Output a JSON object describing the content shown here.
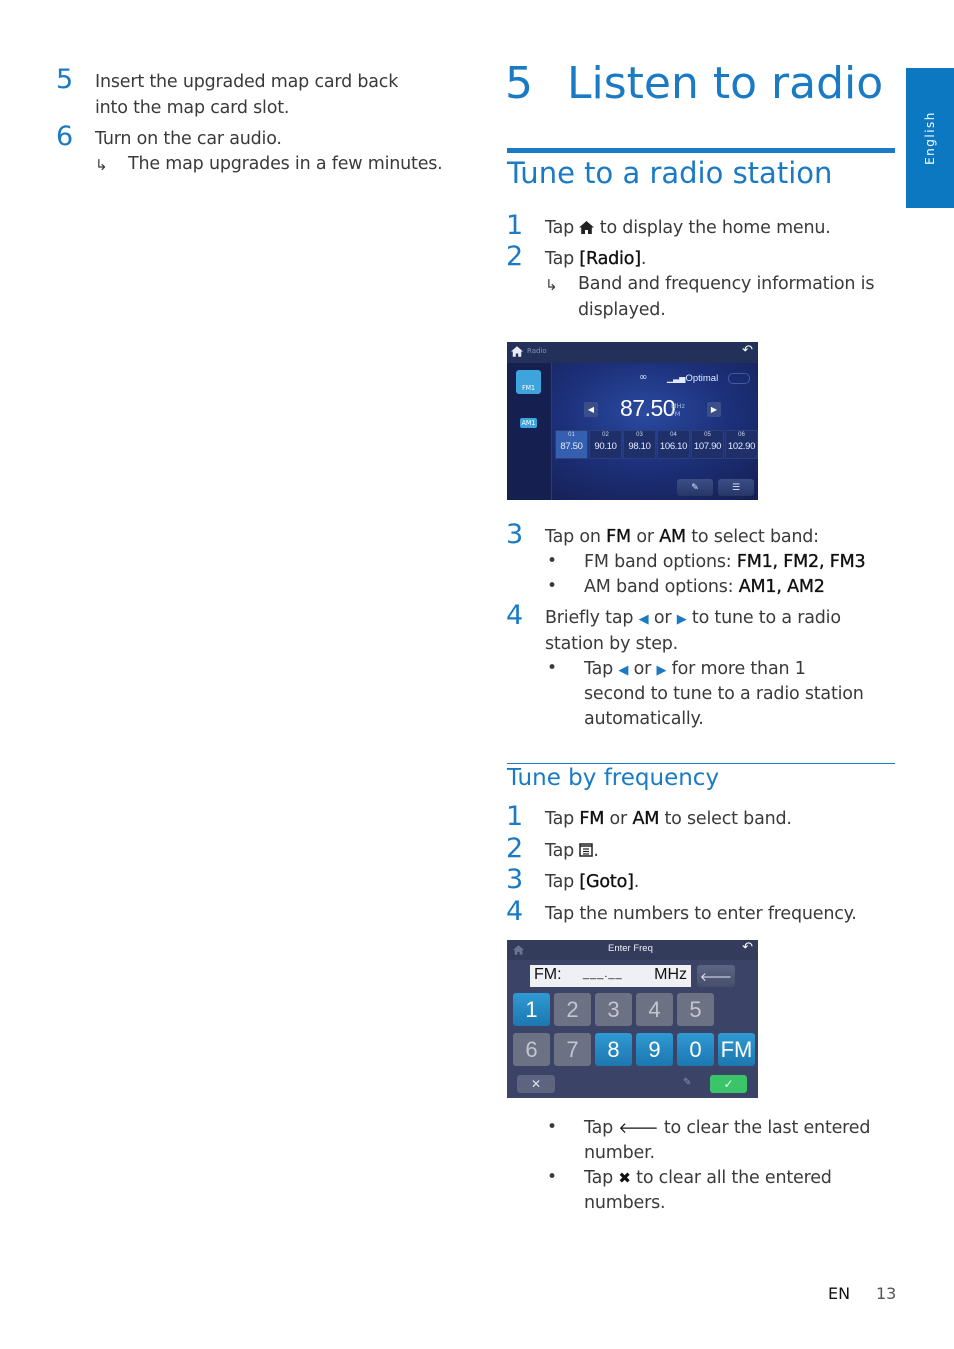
{
  "left_column": {
    "steps": [
      {
        "num": "5",
        "text": "Insert the upgraded map card back into the map card slot."
      },
      {
        "num": "6",
        "text": "Turn on the car audio.",
        "result": "The map upgrades in a few minutes."
      }
    ]
  },
  "chapter": {
    "number": "5",
    "title": "Listen to radio"
  },
  "section1": {
    "title": "Tune to a radio station",
    "step1": {
      "num": "1",
      "pre": "Tap",
      "icon": "home-icon",
      "post": "to display the home menu."
    },
    "step2": {
      "num": "2",
      "pre": "Tap",
      "key": "[Radio]",
      "post": ".",
      "result_line1": "Band and frequency information is",
      "result_line2": "displayed."
    },
    "step3": {
      "num": "3",
      "pre": "Tap on",
      "k1": "FM",
      "mid": "or",
      "k2": "AM",
      "post": "to select band:",
      "bullet1_pre": "FM band options:",
      "bullet1_key": "FM1, FM2, FM3",
      "bullet2_pre": "AM band options:",
      "bullet2_key": "AM1, AM2"
    },
    "step4": {
      "num": "4",
      "line1_pre": "Briefly tap",
      "or": "or",
      "line1_post": "to tune to a radio",
      "line2": "station by step.",
      "bullet_pre": "Tap",
      "bullet_or": "or",
      "bullet_post": "for more than 1",
      "bullet_line2": "second to tune to a radio station",
      "bullet_line3": "automatically."
    }
  },
  "radio_screen": {
    "top_label": "Radio",
    "bands": [
      "FM1",
      "AM1"
    ],
    "sound_mode": "Optimal",
    "frequency": "87.50",
    "unit": "MHz",
    "band": "FM",
    "presets": [
      {
        "num": "01",
        "freq": "87.50",
        "selected": true
      },
      {
        "num": "02",
        "freq": "90.10"
      },
      {
        "num": "03",
        "freq": "98.10"
      },
      {
        "num": "04",
        "freq": "106.10"
      },
      {
        "num": "05",
        "freq": "107.90"
      },
      {
        "num": "06",
        "freq": "102.90"
      }
    ]
  },
  "section2": {
    "title": "Tune by frequency",
    "steps": [
      {
        "num": "1",
        "pre": "Tap",
        "k1": "FM",
        "mid": "or",
        "k2": "AM",
        "post": "to select band."
      },
      {
        "num": "2",
        "pre": "Tap",
        "icon": "menu-list-icon",
        "post": "."
      },
      {
        "num": "3",
        "pre": "Tap",
        "key": "[Goto]",
        "post": "."
      },
      {
        "num": "4",
        "text": "Tap the numbers to enter frequency."
      }
    ],
    "bullets": [
      {
        "pre": "Tap",
        "icon": "backspace-arrow-icon",
        "post": "to clear the last entered",
        "line2": "number."
      },
      {
        "pre": "Tap",
        "icon": "x-icon",
        "post": "to clear all the entered",
        "line2": "numbers."
      }
    ]
  },
  "freq_screen": {
    "title": "Enter Freq",
    "display_band": "FM:",
    "display_value": "___.__",
    "display_unit": "MHz",
    "keys_row1": [
      {
        "label": "1",
        "on": true
      },
      {
        "label": "2",
        "on": false
      },
      {
        "label": "3",
        "on": false
      },
      {
        "label": "4",
        "on": false
      },
      {
        "label": "5",
        "on": false
      }
    ],
    "keys_row2": [
      {
        "label": "6",
        "on": false
      },
      {
        "label": "7",
        "on": false
      },
      {
        "label": "8",
        "on": true
      },
      {
        "label": "9",
        "on": true
      },
      {
        "label": "0",
        "on": true
      },
      {
        "label": "FM",
        "on": true
      }
    ]
  },
  "side_tab": {
    "label": "English"
  },
  "footer": {
    "lang": "EN",
    "page": "13"
  },
  "colors": {
    "accent": "#1a7ac4",
    "side_tab": "#0c78c2"
  }
}
